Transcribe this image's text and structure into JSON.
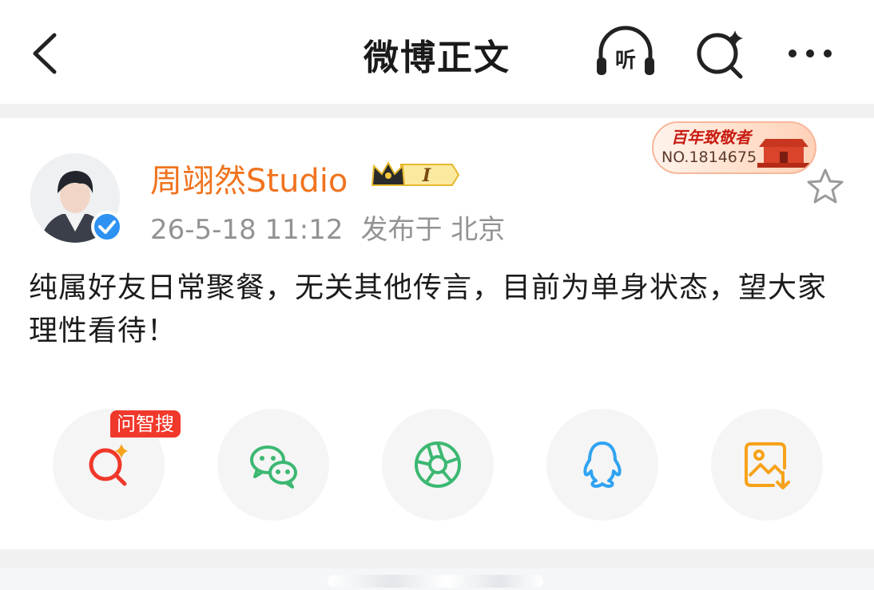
{
  "navbar": {
    "title": "微博正文",
    "listen_icon": "headphones-listen-icon",
    "listen_label": "听",
    "search_icon": "sparkle-search-icon",
    "more_icon": "more-dots-icon"
  },
  "post": {
    "author": "周翊然Studio",
    "vip_level": "I",
    "timestamp": "26-5-18 11:12",
    "location": "发布于 北京",
    "fan_badge": {
      "title": "百年致敬者",
      "number": "NO.1814675"
    },
    "text": "纯属好友日常聚餐，无关其他传言，目前为单身状态，望大家理性看待！"
  },
  "share": {
    "wenzhisou_label": "问智搜",
    "buttons": [
      {
        "icon": "ai-search-icon",
        "color": "#f0382b"
      },
      {
        "icon": "wechat-icon",
        "color": "#3cb872"
      },
      {
        "icon": "moments-icon",
        "color": "#3cb872"
      },
      {
        "icon": "qq-icon",
        "color": "#2fa3f2"
      },
      {
        "icon": "save-image-icon",
        "color": "#f7a21b"
      }
    ]
  },
  "colors": {
    "username": "#f0731e",
    "meta": "#939393",
    "tag": "#f0382b"
  }
}
